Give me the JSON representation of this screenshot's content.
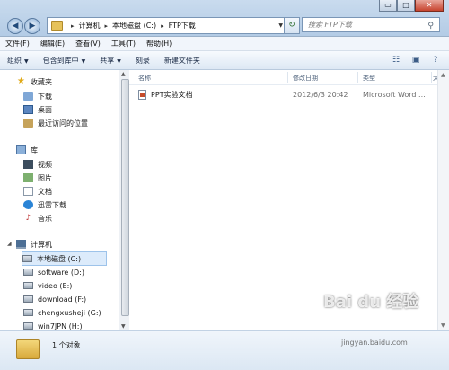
{
  "window": {
    "caption_buttons": [
      "▭",
      "□",
      "✕"
    ],
    "breadcrumbs": [
      "计算机",
      "本地磁盘 (C:)",
      "FTP下载"
    ],
    "search_placeholder": "搜索 FTP下载"
  },
  "menubar": [
    "文件(F)",
    "编辑(E)",
    "查看(V)",
    "工具(T)",
    "帮助(H)"
  ],
  "toolbar": {
    "organize": "组织",
    "include_library": "包含到库中",
    "share": "共享",
    "burn": "刻录",
    "new_folder": "新建文件夹"
  },
  "nav": {
    "favorites": {
      "label": "收藏夹",
      "items": [
        "下载",
        "桌面",
        "最近访问的位置"
      ]
    },
    "libraries": {
      "label": "库",
      "items": [
        "视频",
        "图片",
        "文档",
        "迅雷下载",
        "音乐"
      ]
    },
    "computer": {
      "label": "计算机",
      "items": [
        "本地磁盘 (C:)",
        "software (D:)",
        "video (E:)",
        "download (F:)",
        "chengxusheji (G:)",
        "win7JPN (H:)"
      ]
    }
  },
  "columns": [
    "名称",
    "修改日期",
    "类型",
    "大小"
  ],
  "files": [
    {
      "name": "PPT实验文档",
      "modified": "2012/6/3 20:42",
      "type": "Microsoft Word ..."
    }
  ],
  "status": {
    "count": "1 个对象"
  },
  "watermark": {
    "logo": "Bai du 经验",
    "url": "jingyan.baidu.com"
  }
}
